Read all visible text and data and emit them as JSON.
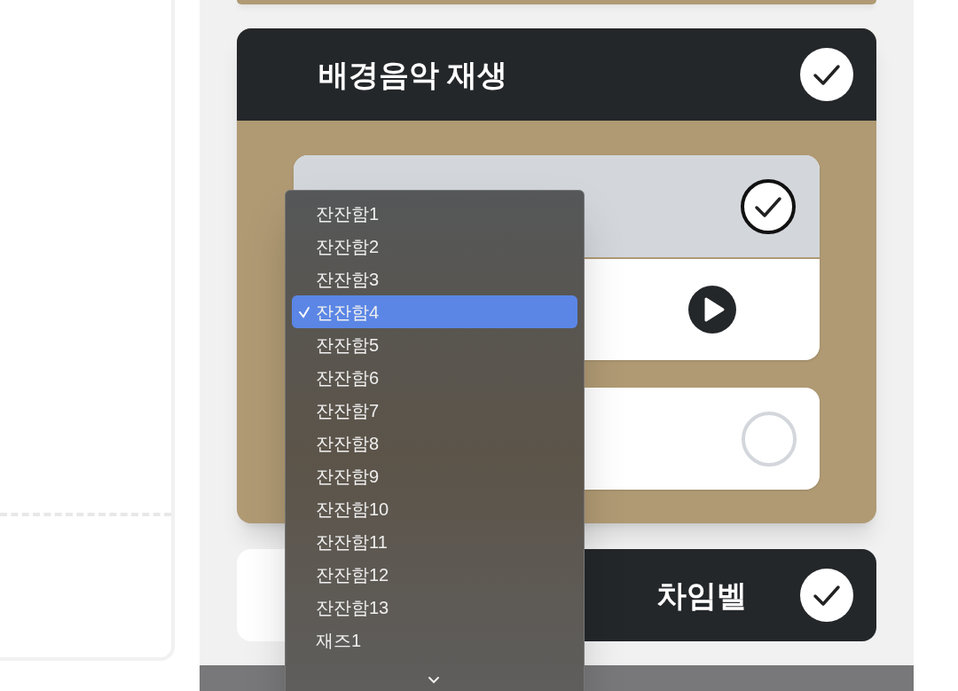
{
  "bgm": {
    "title": "배경음악 재생",
    "checked": true,
    "options": [
      {
        "kind": "toggle",
        "checked": true
      },
      {
        "kind": "player"
      },
      {
        "kind": "radio",
        "checked": false
      }
    ]
  },
  "chime": {
    "title": "차임벨",
    "checked": true
  },
  "dropdown": {
    "items": [
      {
        "label": "잔잔함1",
        "selected": false
      },
      {
        "label": "잔잔함2",
        "selected": false
      },
      {
        "label": "잔잔함3",
        "selected": false
      },
      {
        "label": "잔잔함4",
        "selected": true
      },
      {
        "label": "잔잔함5",
        "selected": false
      },
      {
        "label": "잔잔함6",
        "selected": false
      },
      {
        "label": "잔잔함7",
        "selected": false
      },
      {
        "label": "잔잔함8",
        "selected": false
      },
      {
        "label": "잔잔함9",
        "selected": false
      },
      {
        "label": "잔잔함10",
        "selected": false
      },
      {
        "label": "잔잔함11",
        "selected": false
      },
      {
        "label": "잔잔함12",
        "selected": false
      },
      {
        "label": "잔잔함13",
        "selected": false
      },
      {
        "label": "재즈1",
        "selected": false
      }
    ]
  }
}
